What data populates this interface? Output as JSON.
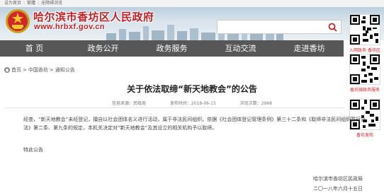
{
  "topbar": {
    "links": [
      "设为首页",
      "繁體",
      "无障碍浏览"
    ]
  },
  "header": {
    "site_title": "哈尔滨市香坊区人民政府",
    "site_url": "www.hrbxf.gov.cn",
    "search_placeholder": ""
  },
  "nav": {
    "items": [
      "首 页",
      "政务公开",
      "政务服务",
      "互动交流",
      "走进香坊"
    ]
  },
  "sidebar_qr": {
    "labels": [
      "入网政务·香坊区",
      "香坊微政务服务",
      "香坊发布"
    ]
  },
  "breadcrumb": {
    "home": "首页",
    "level1": "中国香坊",
    "level2": "通知公告",
    "sep": ">"
  },
  "article": {
    "title": "关于依法取缔“新天地教会”的公告",
    "source": "信息来源：民政局",
    "date": "发布时间：2018-06-15",
    "views": "浏览次数：2968",
    "body": "经查，“新天地教会”未经登记，擅自以社会团体名义进行活动，属于非法民间组织。依据《社会团体登记管理条例》第三十二条和《取缔非法民间组织暂行办法》第二条、第九条的规定，本机关决定对“新天地教会”及其设立的相关机构予以取缔。",
    "closing": "特此公告",
    "signature_org": "哈尔滨市香坊区民政局",
    "signature_date": "二〇一八年六月十五日"
  },
  "colors": {
    "brand_red": "#c21f24",
    "nav_bg": "#575757"
  },
  "icons": {
    "emblem": "emblem-icon",
    "search": "search-icon",
    "home": "home-icon"
  }
}
